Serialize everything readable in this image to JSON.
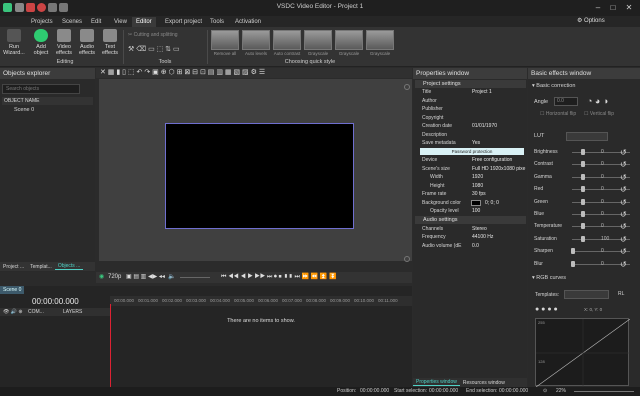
{
  "app": {
    "title": "VSDC Video Editor - Project 1",
    "options_label": "Options"
  },
  "menu": {
    "items": [
      "Projects",
      "Scenes",
      "Edit",
      "View",
      "Editor",
      "Export project",
      "Tools",
      "Activation"
    ],
    "active": "Editor"
  },
  "ribbon": {
    "buttons": [
      {
        "label": "Run\nWizard...",
        "color": "#3a3a3a"
      },
      {
        "label": "Add\nobject",
        "color": "#2ecc71"
      },
      {
        "label": "Video\neffects",
        "color": "#3b82c4"
      },
      {
        "label": "Audio\neffects",
        "color": "#888888"
      },
      {
        "label": "Text\neffects",
        "color": "#777777"
      }
    ],
    "editing_label": "Editing",
    "tools_label": "Tools",
    "cutting_label": "Cutting and splitting",
    "quick_style_label": "Choosing quick style",
    "quick_styles": [
      "Remove all",
      "Auto levels",
      "Auto contrast",
      "Grayscale",
      "Grayscale",
      "Grayscale"
    ]
  },
  "objects_explorer": {
    "title": "Objects explorer",
    "search_placeholder": "Search objects",
    "column_header": "OBJECT NAME",
    "items": [
      "Scene 0"
    ],
    "bottom_tabs": [
      "Project ...",
      "Templat...",
      "Objects ..."
    ]
  },
  "properties": {
    "title": "Properties window",
    "sections": {
      "project": "Project settings",
      "audio": "Audio settings"
    },
    "rows": [
      {
        "k": "Title",
        "v": "Project 1"
      },
      {
        "k": "Author",
        "v": ""
      },
      {
        "k": "Publisher",
        "v": ""
      },
      {
        "k": "Copyright",
        "v": ""
      },
      {
        "k": "Creation date",
        "v": "01/01/1970"
      },
      {
        "k": "Description",
        "v": ""
      },
      {
        "k": "Save metadata",
        "v": "Yes"
      }
    ],
    "password_button": "Password protection",
    "rows2": [
      {
        "k": "Device",
        "v": "Free configuration"
      },
      {
        "k": "Scene's size",
        "v": "Full HD 1920x1080 pixe"
      },
      {
        "k": "Width",
        "v": "1920"
      },
      {
        "k": "Height",
        "v": "1080"
      },
      {
        "k": "Frame rate",
        "v": "30 fps"
      },
      {
        "k": "Background color",
        "v": "0; 0; 0"
      },
      {
        "k": "Opacity level",
        "v": "100"
      }
    ],
    "audio_rows": [
      {
        "k": "Channels",
        "v": "Stereo"
      },
      {
        "k": "Frequency",
        "v": "44100 Hz"
      },
      {
        "k": "Audio volume (dE",
        "v": "0.0"
      }
    ],
    "bottom_tabs": [
      "Properties window",
      "Resources window"
    ]
  },
  "basic_effects": {
    "title": "Basic effects window",
    "basic_correction": "Basic correction",
    "angle_label": "Angle",
    "angle_value": "0.0",
    "hflip": "Horizontal flip",
    "vflip": "Vertical flip",
    "lut_label": "LUT",
    "sliders": [
      {
        "k": "Brightness",
        "v": "0",
        "pos": 0.5
      },
      {
        "k": "Contrast",
        "v": "0",
        "pos": 0.5
      },
      {
        "k": "Gamma",
        "v": "0",
        "pos": 0.5
      },
      {
        "k": "Red",
        "v": "0",
        "pos": 0.5
      },
      {
        "k": "Green",
        "v": "0",
        "pos": 0.5
      },
      {
        "k": "Blue",
        "v": "0",
        "pos": 0.5
      },
      {
        "k": "Temperature",
        "v": "0",
        "pos": 0.5
      },
      {
        "k": "Saturation",
        "v": "100",
        "pos": 0.5
      },
      {
        "k": "Sharpen",
        "v": "0",
        "pos": 0.05
      },
      {
        "k": "Blur",
        "v": "0",
        "pos": 0.05
      }
    ],
    "rgb_curves": "RGB curves",
    "templates_label": "Templates:",
    "curve_coords": "X: 0, Y: 0",
    "curve_top": "255",
    "curve_mid": "128",
    "curve_in": "In:"
  },
  "preview": {
    "quality": "720p"
  },
  "timeline": {
    "scene_tab": "Scene 0",
    "timecode": "00:00:00.000",
    "ticks": [
      "00:00.000",
      "00:01.000",
      "00:02.000",
      "00:03.000",
      "00:04.000",
      "00:05.000",
      "00:06.000",
      "00:07.000",
      "00:08.000",
      "00:09.000",
      "00:10.000",
      "00:11.000"
    ],
    "com_label": "COM...",
    "layers_label": "LAYERS",
    "empty_text": "There are no items to show."
  },
  "statusbar": {
    "position_label": "Position:",
    "position_value": "00:00:00.000",
    "start_label": "Start selection:",
    "start_value": "00:00:00.000",
    "end_label": "End selection:",
    "end_value": "00:00:00.000",
    "zoom": "22%"
  }
}
